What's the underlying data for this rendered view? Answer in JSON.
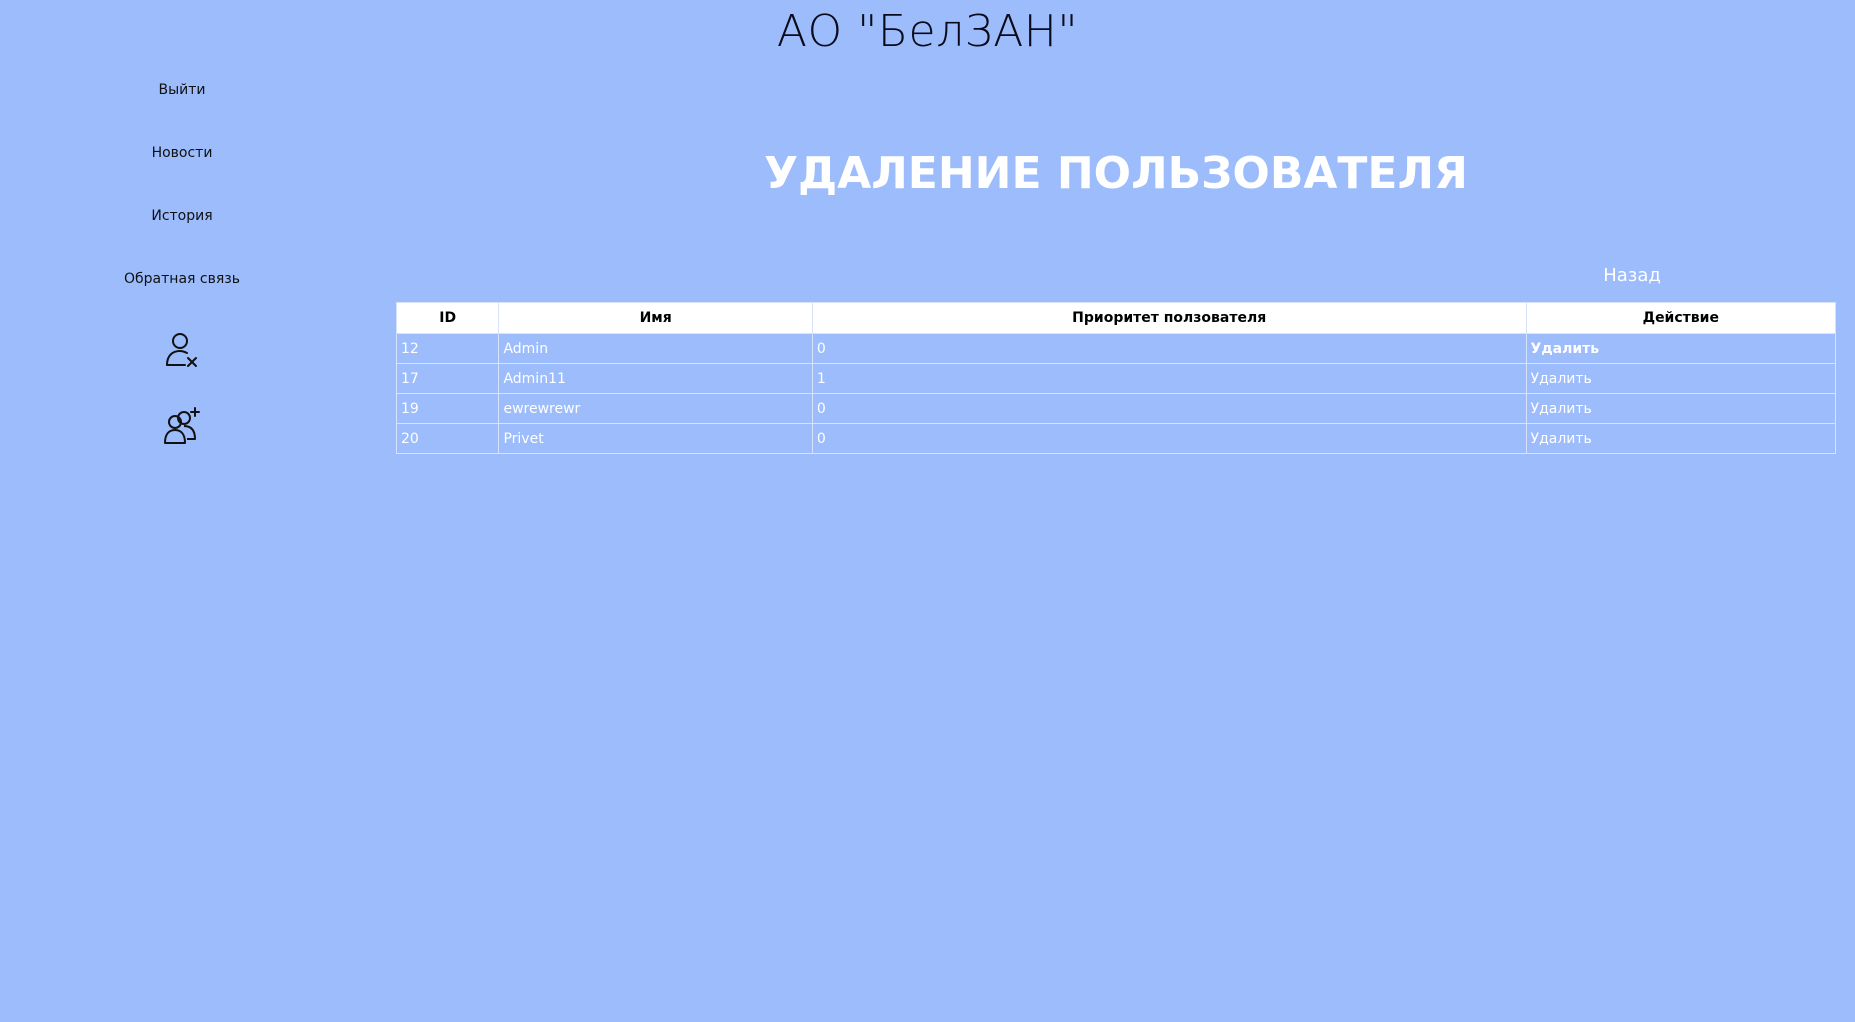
{
  "header": {
    "site_title": "АО \"БелЗАН\""
  },
  "sidebar": {
    "items": [
      {
        "label": "Выйти"
      },
      {
        "label": "Новости"
      },
      {
        "label": "История"
      },
      {
        "label": "Обратная связь"
      }
    ],
    "icons": [
      {
        "name": "remove-user-icon"
      },
      {
        "name": "add-users-icon"
      }
    ]
  },
  "main": {
    "heading": "УДАЛЕНИЕ ПОЛЬЗОВАТЕЛЯ",
    "back_label": "Назад",
    "table": {
      "headers": [
        "ID",
        "Имя",
        "Приоритет ползователя",
        "Действие"
      ],
      "rows": [
        {
          "id": "12",
          "name": "Admin",
          "priority": "0",
          "action": "Удалить"
        },
        {
          "id": "17",
          "name": "Admin11",
          "priority": "1",
          "action": "Удалить"
        },
        {
          "id": "19",
          "name": "ewrewrewr",
          "priority": "0",
          "action": "Удалить"
        },
        {
          "id": "20",
          "name": "Privet",
          "priority": "0",
          "action": "Удалить"
        }
      ]
    }
  },
  "colors": {
    "background": "#9cbcfc",
    "table_header_bg": "#ffffff",
    "heading_text": "#ffffff"
  }
}
